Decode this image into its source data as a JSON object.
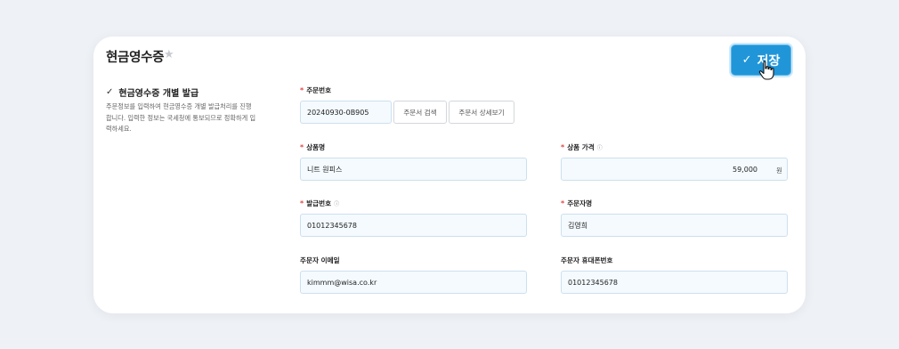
{
  "page": {
    "title": "현금영수증",
    "save_label": "저장"
  },
  "section": {
    "title": "현금영수증 개별 발급",
    "description": "주문정보를 입력하여 현금영수증 개별 발급처리를 진행합니다. 입력한 정보는 국세청에 통보되므로 정확하게 입력하세요."
  },
  "form": {
    "order_number": {
      "label": "주문번호",
      "value": "20240930-0B905",
      "search_label": "주문서 검색",
      "detail_label": "주문서 상세보기"
    },
    "product_name": {
      "label": "상품명",
      "value": "니트 원피스"
    },
    "product_price": {
      "label": "상품 가격",
      "value": "59,000",
      "unit": "원"
    },
    "issue_number": {
      "label": "발급번호",
      "value": "01012345678"
    },
    "orderer_name": {
      "label": "주문자명",
      "value": "김영희"
    },
    "orderer_email": {
      "label": "주문자 이메일",
      "value": "kimmm@wisa.co.kr"
    },
    "orderer_phone": {
      "label": "주문자 휴대폰번호",
      "value": "01012345678"
    }
  }
}
